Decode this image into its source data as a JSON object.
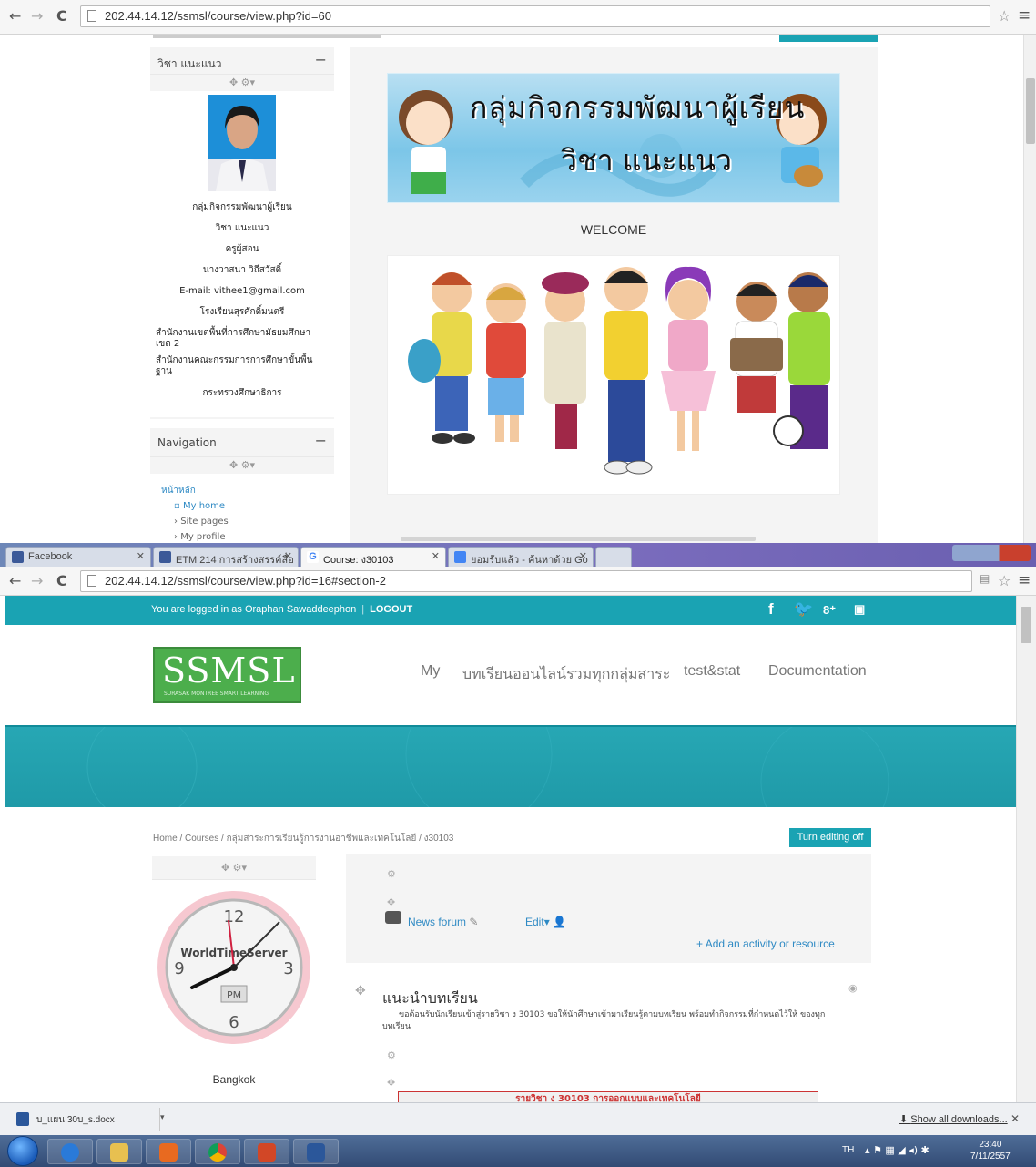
{
  "window1": {
    "url": "202.44.14.12/ssmsl/course/view.php?id=60",
    "profile_block": {
      "title": "วิชา แนะแนว",
      "lines": [
        "กลุ่มกิจกรรมพัฒนาผู้เรียน",
        "วิชา แนะแนว",
        "ครูผู้สอน",
        "นางวาสนา วิถีสวัสดิ์",
        "E-mail: vithee1@gmail.com",
        "โรงเรียนสุรศักดิ์มนตรี",
        "สำนักงานเขตพื้นที่การศึกษามัธยมศึกษา เขต 2",
        "สำนักงานคณะกรรมการการศึกษาขั้นพื้นฐาน",
        "กระทรวงศึกษาธิการ"
      ]
    },
    "nav_block": {
      "title": "Navigation",
      "home": "หน้าหลัก",
      "items": [
        "My home",
        "Site pages",
        "My profile"
      ]
    },
    "banner": {
      "line1": "กลุ่มกิจกรรมพัฒนาผู้เรียน",
      "line2": "วิชา แนะแนว"
    },
    "welcome": "WELCOME"
  },
  "window2": {
    "tabs": [
      {
        "label": "Facebook",
        "color": "#3b5998"
      },
      {
        "label": "ETM 214 การสร้างสรรค์สื่อ",
        "color": "#3b5998"
      },
      {
        "label": "Course: ง30103",
        "color": "#4285f4"
      },
      {
        "label": "ยอมรับแล้ว - ค้นหาด้วย Go",
        "color": "#4285f4"
      }
    ],
    "url": "202.44.14.12/ssmsl/course/view.php?id=16#section-2",
    "login": {
      "text": "You are logged in as Oraphan Sawaddeephon",
      "logout": "LOGOUT"
    },
    "social_icons": [
      "f",
      "t",
      "8+",
      "yt"
    ],
    "logo": {
      "text": "SSMSL",
      "subtext": "SURASAK MONTREE SMART LEARNING"
    },
    "topnav": [
      "My",
      "บทเรียนออนไลน์รวมทุกกลุ่มสาระ",
      "test&stat",
      "Documentation"
    ],
    "breadcrumb": "Home / Courses / กลุ่มสาระการเรียนรู้การงานอาชีพและเทคโนโลยี / ง30103",
    "edit_button": "Turn editing off",
    "clock": {
      "brand": "WorldTimeServer",
      "ampm": "PM",
      "city": "Bangkok",
      "n12": "12",
      "n3": "3",
      "n6": "6",
      "n9": "9"
    },
    "course": {
      "news_forum": "News forum",
      "edit": "Edit",
      "add_activity": "Add an activity or resource",
      "section_title": "แนะนำบทเรียน",
      "section_desc": "ขอต้อนรับนักเรียนเข้าสู่รายวิชา ง 30103 ขอให้นักศึกษาเข้ามาเรียนรู้ตามบทเรียน พร้อมทำกิจกรรมที่กำหนดไว้ให้ ของทุกบทเรียน",
      "section_img_text": "รายวิชา ง 30103 การออกแบบและเทคโนโลยี"
    }
  },
  "downloads": {
    "file": "บ_แผน 30บ_s.docx",
    "show_all": "Show all downloads..."
  },
  "taskbar": {
    "lang": "TH",
    "time": "23:40",
    "date": "7/11/2557"
  },
  "colors": {
    "teal": "#1aa3b3",
    "link": "#2f8ac4",
    "logo_green": "#4cae4c"
  }
}
